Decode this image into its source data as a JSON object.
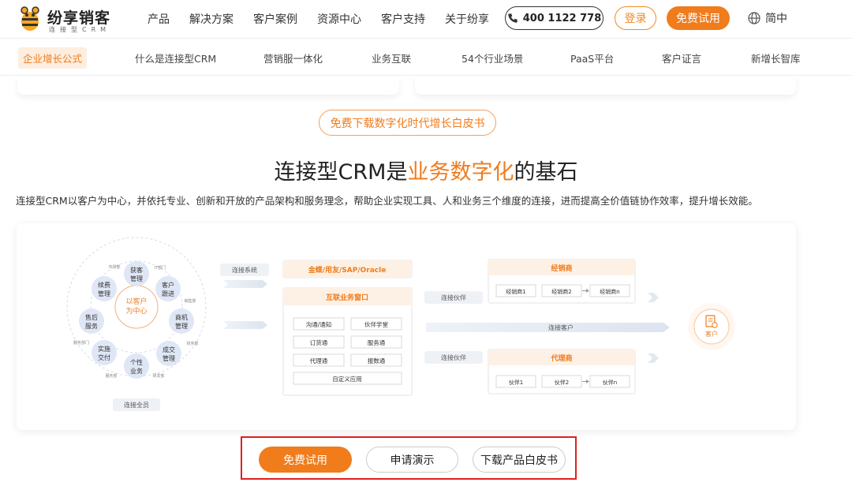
{
  "brand": {
    "name": "纷享销客",
    "sub": "连接型CRM"
  },
  "header": {
    "nav": [
      "产品",
      "解决方案",
      "客户案例",
      "资源中心",
      "客户支持",
      "关于纷享"
    ],
    "phone": "400 1122 778",
    "login": "登录",
    "trial": "免费试用",
    "lang": "简中"
  },
  "subnav": {
    "items": [
      "企业增长公式",
      "什么是连接型CRM",
      "营销服一体化",
      "业务互联",
      "54个行业场景",
      "PaaS平台",
      "客户证言",
      "新增长智库"
    ]
  },
  "main": {
    "whitepaper_btn": "免费下载数字化时代增长白皮书",
    "headline_pre": "连接型CRM是",
    "headline_hl": "业务数字化",
    "headline_post": "的基石",
    "description": "连接型CRM以客户为中心，并依托专业、创新和开放的产品架构和服务理念，帮助企业实现工具、人和业务三个维度的连接，进而提高全价值链协作效率，提升增长效能。"
  },
  "diagram": {
    "center": [
      "以客户",
      "为中心"
    ],
    "wheel": [
      [
        "获客",
        "管理"
      ],
      [
        "客户",
        "跟进"
      ],
      [
        "商机",
        "管理"
      ],
      [
        "成交",
        "管理"
      ],
      [
        "个性",
        "业务"
      ],
      [
        "实施",
        "交付"
      ],
      [
        "售后",
        "服务"
      ],
      [
        "续费",
        "管理"
      ]
    ],
    "depts": [
      "市场部",
      "IT部门",
      "销售部",
      "财务部",
      "研发部",
      "服务部",
      "服务部门"
    ],
    "connect_all": "连接全员",
    "connect_systems": "连接系统",
    "erp": "金蝶/用友/SAP/Oracle",
    "window_title": "互联业务窗口",
    "window_items": [
      "沟通/通知",
      "伙伴学堂",
      "订货通",
      "服务通",
      "代理通",
      "报数通"
    ],
    "custom_app": "自定义应用",
    "connect_partner_1": "连接伙伴",
    "connect_partner_2": "连接伙伴",
    "connect_customer": "连接客户",
    "distributor_title": "经销商",
    "distributors": [
      "经销商1",
      "经销商2",
      "经销商n"
    ],
    "agent_title": "代理商",
    "agents": [
      "伙伴1",
      "伙伴2",
      "伙伴n"
    ],
    "customer": "客户"
  },
  "cta": {
    "trial": "免费试用",
    "demo": "申请演示",
    "paper": "下载产品白皮书"
  },
  "colors": {
    "accent": "#f07c1c",
    "highlight_box": "#e02020",
    "wheel": "#dfe6f5"
  }
}
